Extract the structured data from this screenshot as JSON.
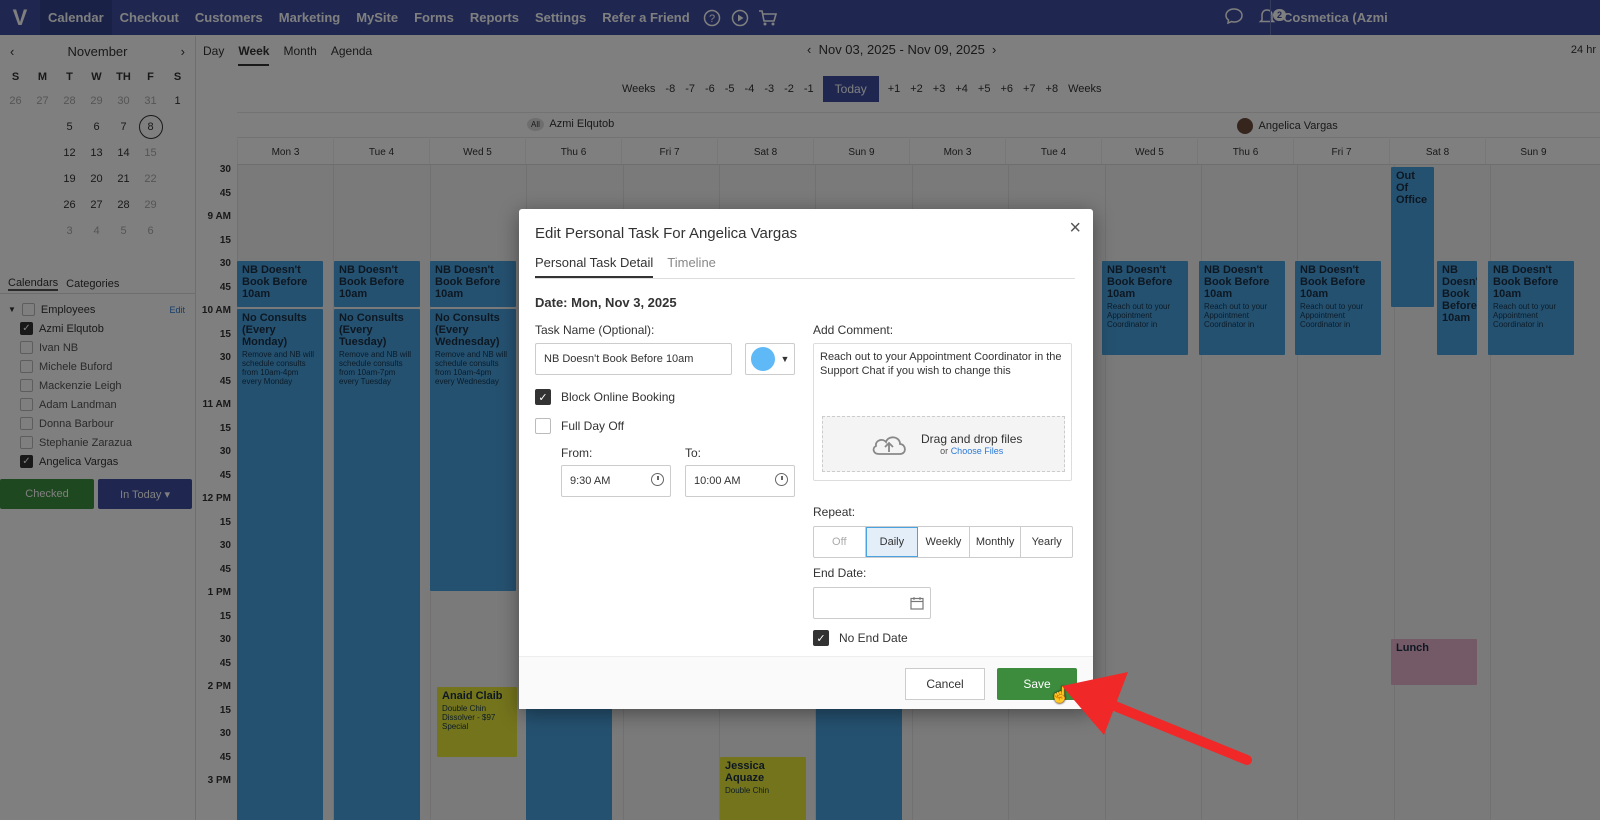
{
  "nav": {
    "logo": "V",
    "items": [
      "Calendar",
      "Checkout",
      "Customers",
      "Marketing",
      "MySite",
      "Forms",
      "Reports",
      "Settings",
      "Refer a Friend"
    ],
    "notif_count": "2",
    "account": "Cosmetica (Azmi"
  },
  "sidebar": {
    "month": "November",
    "dow": [
      "S",
      "M",
      "T",
      "W",
      "TH",
      "F",
      "S"
    ],
    "weeks": [
      [
        "26",
        "27",
        "28",
        "29",
        "30",
        "31",
        "1"
      ],
      [
        "",
        "",
        "5",
        "6",
        "7",
        "8",
        ""
      ],
      [
        "",
        "",
        "12",
        "13",
        "14",
        "15",
        ""
      ],
      [
        "",
        "",
        "19",
        "20",
        "21",
        "22",
        ""
      ],
      [
        "",
        "",
        "26",
        "27",
        "28",
        "29",
        ""
      ],
      [
        "",
        "",
        "3",
        "4",
        "5",
        "6",
        ""
      ]
    ],
    "tab_calendars": "Calendars",
    "tab_categories": "Categories",
    "employees_label": "Employees",
    "edit_label": "Edit",
    "employees": [
      {
        "name": "Azmi Elqutob",
        "checked": true
      },
      {
        "name": "Ivan NB",
        "checked": false
      },
      {
        "name": "Michele Buford",
        "checked": false
      },
      {
        "name": "Mackenzie Leigh",
        "checked": false
      },
      {
        "name": "Adam Landman",
        "checked": false
      },
      {
        "name": "Donna Barbour",
        "checked": false
      },
      {
        "name": "Stephanie Zarazua",
        "checked": false
      },
      {
        "name": "Angelica Vargas",
        "checked": true
      }
    ],
    "checked_btn": "Checked",
    "in_today_btn": "In Today ▾"
  },
  "calendar": {
    "views": [
      "Day",
      "Week",
      "Month",
      "Agenda"
    ],
    "range": "Nov 03, 2025 - Nov 09, 2025",
    "hrs": "24 hr",
    "weeks_label": "Weeks",
    "minus": [
      "-8",
      "-7",
      "-6",
      "-5",
      "-4",
      "-3",
      "-2",
      "-1"
    ],
    "today": "Today",
    "plus": [
      "+1",
      "+2",
      "+3",
      "+4",
      "+5",
      "+6",
      "+7",
      "+8"
    ],
    "all_label": "All",
    "staff1": "Azmi Elqutob",
    "staff2": "Angelica Vargas",
    "days": [
      "Mon 3",
      "Tue 4",
      "Wed 5",
      "Thu 6",
      "Fri 7",
      "Sat 8",
      "Sun 9",
      "Mon 3",
      "Tue 4",
      "Wed 5",
      "Thu 6",
      "Fri 7",
      "Sat 8",
      "Sun 9"
    ],
    "times": [
      "30",
      "45",
      "9 AM",
      "15",
      "30",
      "45",
      "10 AM",
      "15",
      "30",
      "45",
      "11 AM",
      "15",
      "30",
      "45",
      "12 PM",
      "15",
      "30",
      "45",
      "1 PM",
      "15",
      "30",
      "45",
      "2 PM",
      "15",
      "30",
      "45",
      "3 PM"
    ],
    "evt_nb": "NB Doesn't Book Before 10am",
    "evt_nc_mon": "No Consults (Every Monday)",
    "evt_nc_mon_d": "Remove and NB will schedule consults from 10am-4pm every Monday",
    "evt_nc_tue": "No Consults (Every Tuesday)",
    "evt_nc_tue_d": "Remove and NB will schedule consults from 10am-7pm every Tuesday",
    "evt_nc_wed": "No Consults (Every Wednesday)",
    "evt_nc_wed_d": "Remove and NB will schedule consults from 10am-4pm every Wednesday",
    "evt_reach": "Reach out to your Appointment Coordinator in",
    "evt_ooo": "Out Of Office",
    "evt_anaid": "Anaid Claib",
    "evt_anaid_d": "Double Chin Dissolver - $97 Special",
    "evt_jessica": "Jessica Aquaze",
    "evt_jessica_d": "Double Chin",
    "evt_lunch": "Lunch"
  },
  "modal": {
    "title": "Edit Personal Task For Angelica Vargas",
    "tab_detail": "Personal Task Detail",
    "tab_timeline": "Timeline",
    "date": "Date: Mon, Nov 3, 2025",
    "task_name_label": "Task Name (Optional):",
    "task_name_value": "NB Doesn't Book Before 10am",
    "block_online": "Block Online Booking",
    "full_day_off": "Full Day Off",
    "from_label": "From:",
    "from_value": "9:30 AM",
    "to_label": "To:",
    "to_value": "10:00 AM",
    "comment_label": "Add Comment:",
    "comment_value": "Reach out to your Appointment Coordinator in the Support Chat if you wish to change this",
    "drop_main": "Drag and drop files",
    "drop_or": "or",
    "drop_link": "Choose Files",
    "repeat_label": "Repeat:",
    "repeat_options": [
      "Off",
      "Daily",
      "Weekly",
      "Monthly",
      "Yearly"
    ],
    "repeat_selected": "Daily",
    "end_date_label": "End Date:",
    "no_end_date": "No End Date",
    "cancel": "Cancel",
    "save": "Save",
    "color": "#5fb9f6"
  }
}
